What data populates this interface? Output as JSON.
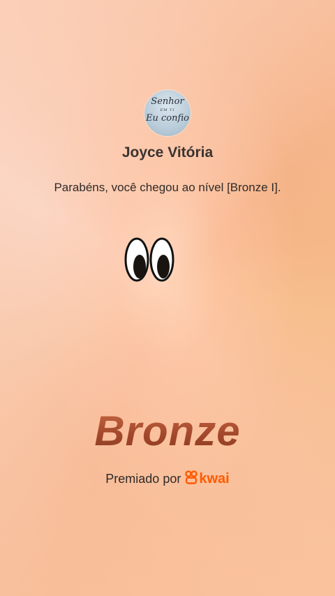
{
  "profile": {
    "avatar_icon": "avatar-icon",
    "avatar_text_line1": "Senhor",
    "avatar_text_line2": "EM TI",
    "avatar_text_line3": "Eu confio",
    "name": "Joyce Vitória"
  },
  "message": "Parabéns, você chegou ao nível [Bronze I].",
  "decoration": {
    "eyes_icon": "eyes-icon"
  },
  "level": {
    "title": "Bronze",
    "color": "#a64b2e"
  },
  "footer": {
    "prefix": "Premiado por",
    "brand": "kwai",
    "brand_color": "#ff5a00",
    "brand_icon": "kwai-logo-icon"
  }
}
